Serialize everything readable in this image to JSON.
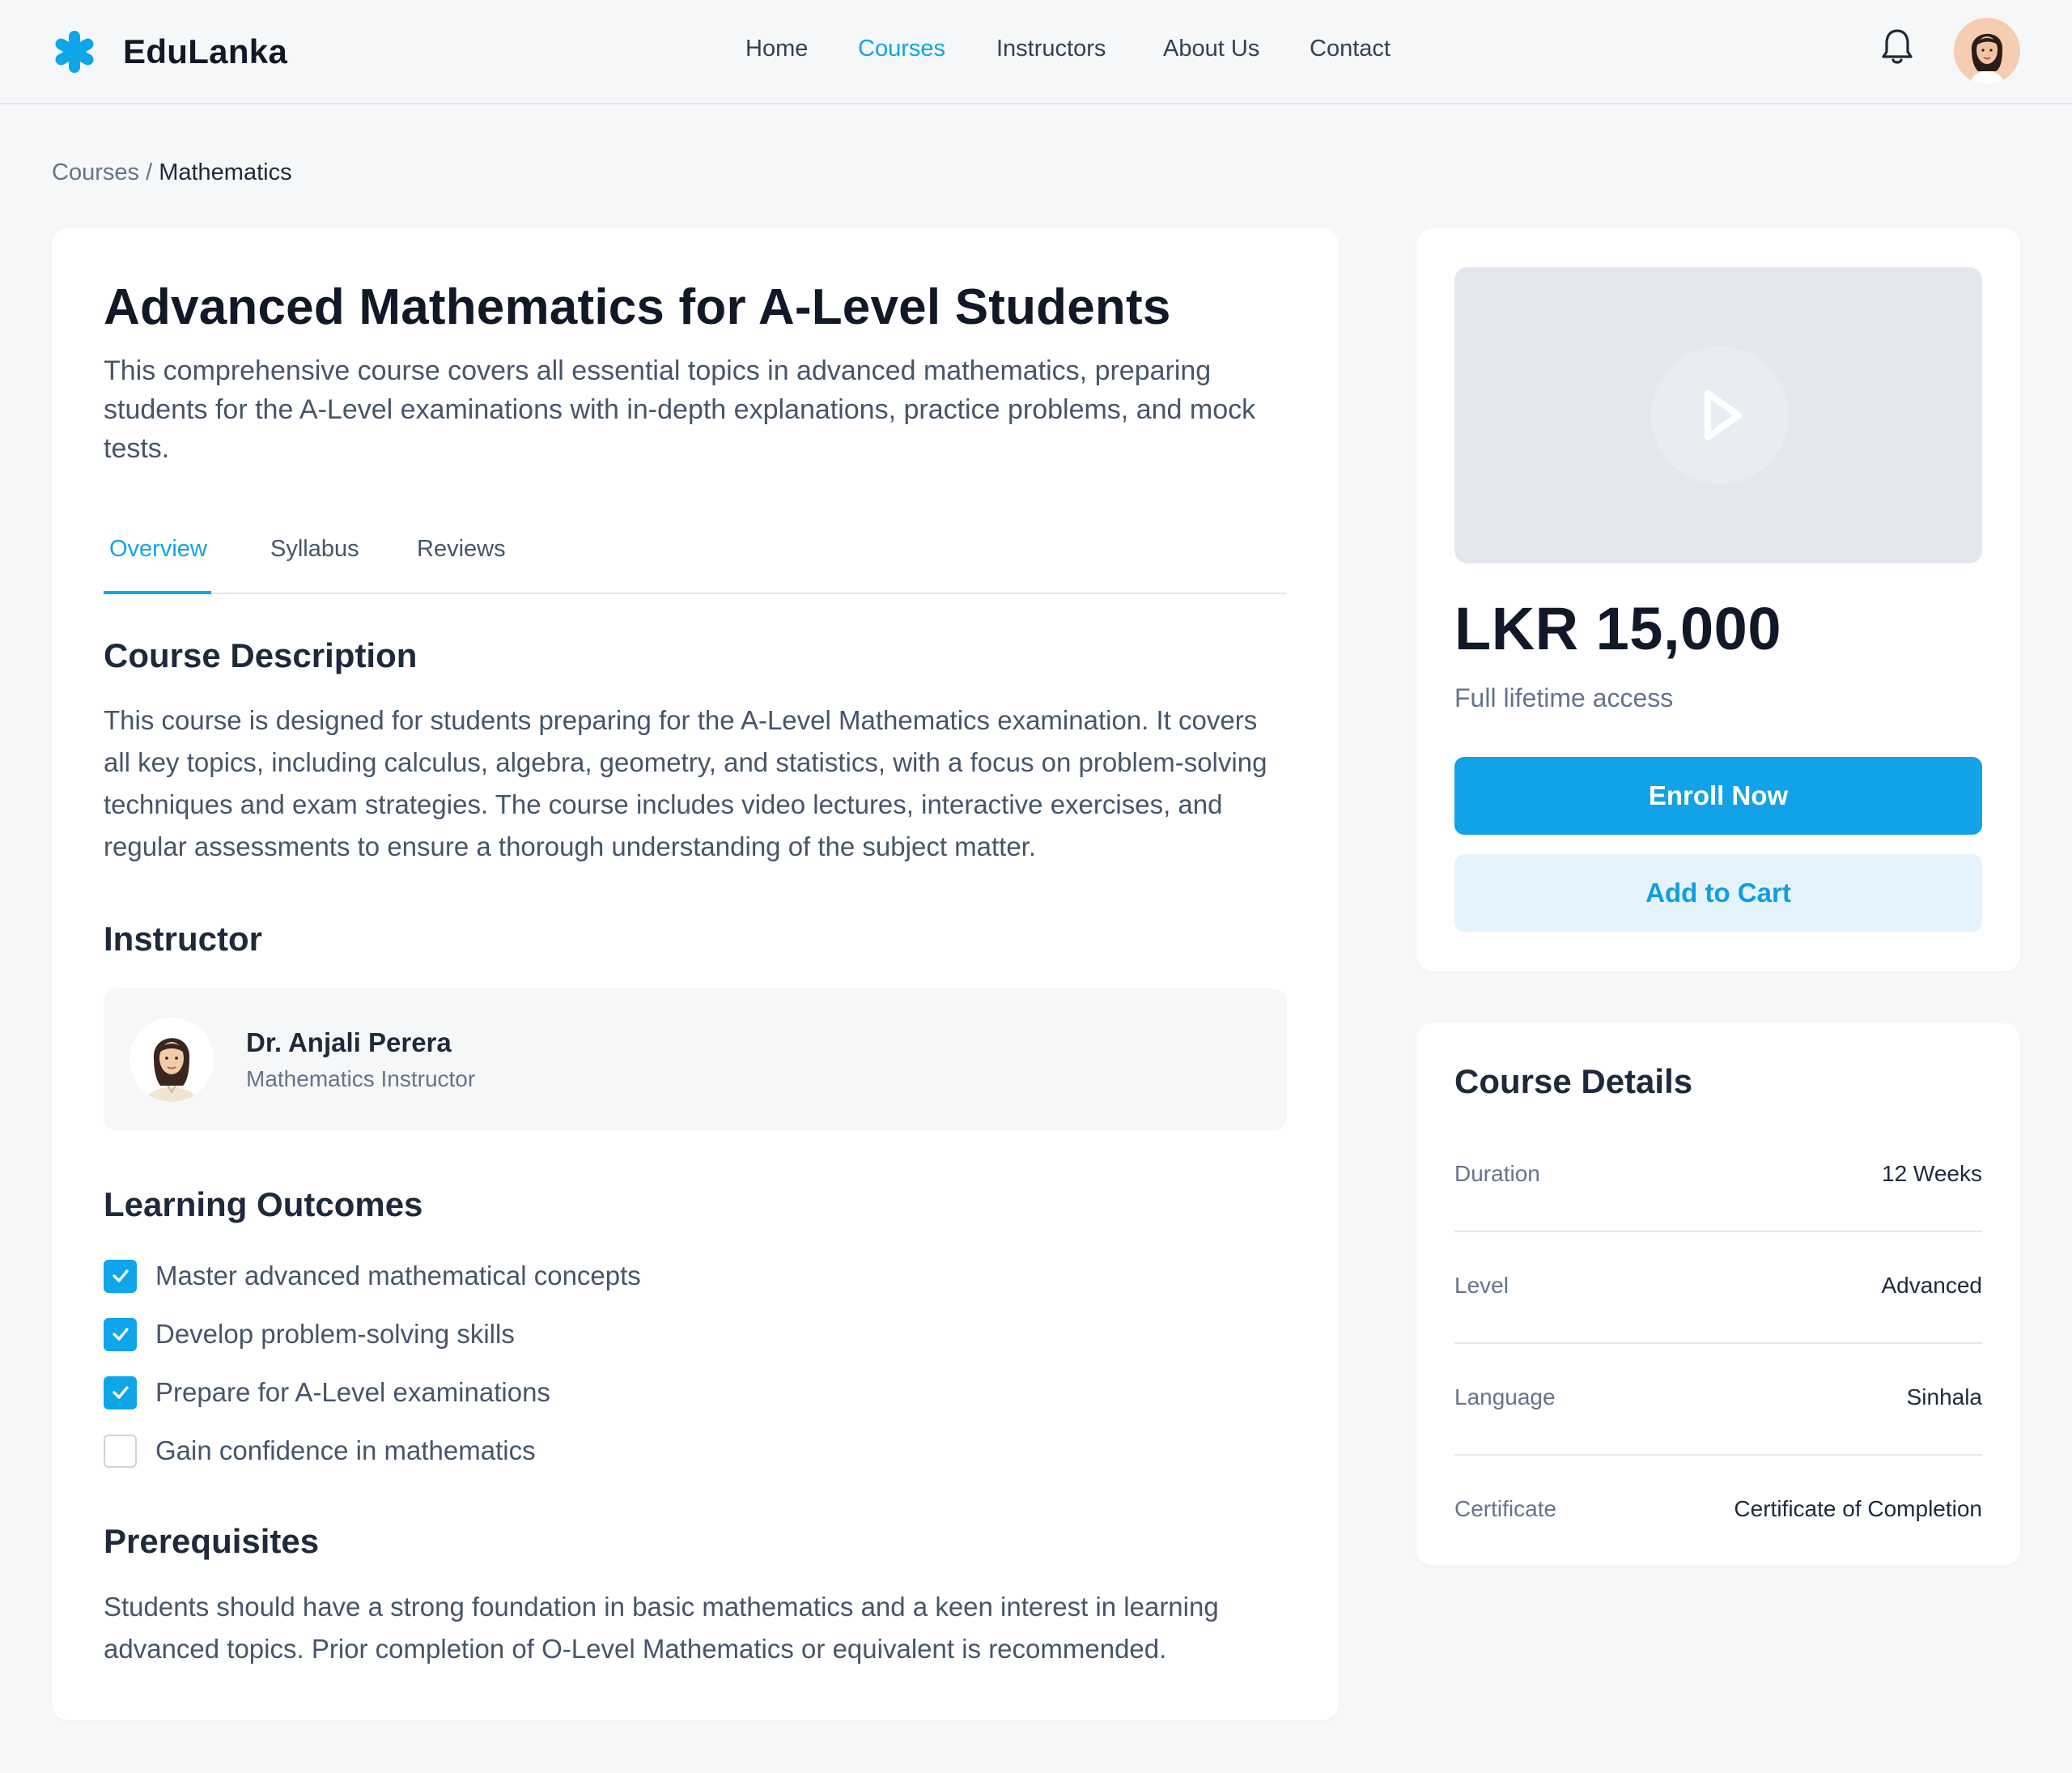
{
  "brand": {
    "name": "EduLanka",
    "accent": "#0ea5e9"
  },
  "nav": {
    "items": [
      {
        "label": "Home",
        "active": false
      },
      {
        "label": "Courses",
        "active": true
      },
      {
        "label": "Instructors",
        "active": false
      },
      {
        "label": "About Us",
        "active": false
      },
      {
        "label": "Contact",
        "active": false
      }
    ]
  },
  "breadcrumb": {
    "parent": "Courses",
    "separator": "/",
    "current": "Mathematics"
  },
  "course": {
    "title": "Advanced Mathematics for A-Level Students",
    "lede": "This comprehensive course covers all essential topics in advanced mathematics, preparing students for the A-Level examinations with in-depth explanations, practice problems, and mock tests."
  },
  "tabs": [
    {
      "label": "Overview",
      "active": true
    },
    {
      "label": "Syllabus",
      "active": false
    },
    {
      "label": "Reviews",
      "active": false
    }
  ],
  "description": {
    "heading": "Course Description",
    "text": "This course is designed for students preparing for the A-Level Mathematics examination. It covers all key topics, including calculus, algebra, geometry, and statistics, with a focus on problem-solving techniques and exam strategies. The course includes video lectures, interactive exercises, and regular assessments to ensure a thorough understanding of the subject matter."
  },
  "instructor": {
    "heading": "Instructor",
    "name": "Dr. Anjali Perera",
    "role": "Mathematics Instructor"
  },
  "outcomes": {
    "heading": "Learning Outcomes",
    "items": [
      {
        "label": "Master advanced mathematical concepts",
        "checked": true
      },
      {
        "label": "Develop problem-solving skills",
        "checked": true
      },
      {
        "label": "Prepare for A-Level examinations",
        "checked": true
      },
      {
        "label": "Gain confidence in mathematics",
        "checked": false
      }
    ]
  },
  "prerequisites": {
    "heading": "Prerequisites",
    "text": "Students should have a strong foundation in basic mathematics and a keen interest in learning advanced topics. Prior completion of O-Level Mathematics or equivalent is recommended."
  },
  "pricing": {
    "price": "LKR 15,000",
    "note": "Full lifetime access",
    "enroll_label": "Enroll Now",
    "cart_label": "Add to Cart"
  },
  "details": {
    "heading": "Course Details",
    "rows": [
      {
        "key": "Duration",
        "value": "12 Weeks"
      },
      {
        "key": "Level",
        "value": "Advanced"
      },
      {
        "key": "Language",
        "value": "Sinhala"
      },
      {
        "key": "Certificate",
        "value": "Certificate of Completion"
      }
    ]
  },
  "icons": {
    "logo": "asterisk-logo-icon",
    "notifications": "bell-icon",
    "play": "play-icon",
    "check": "check-icon"
  }
}
